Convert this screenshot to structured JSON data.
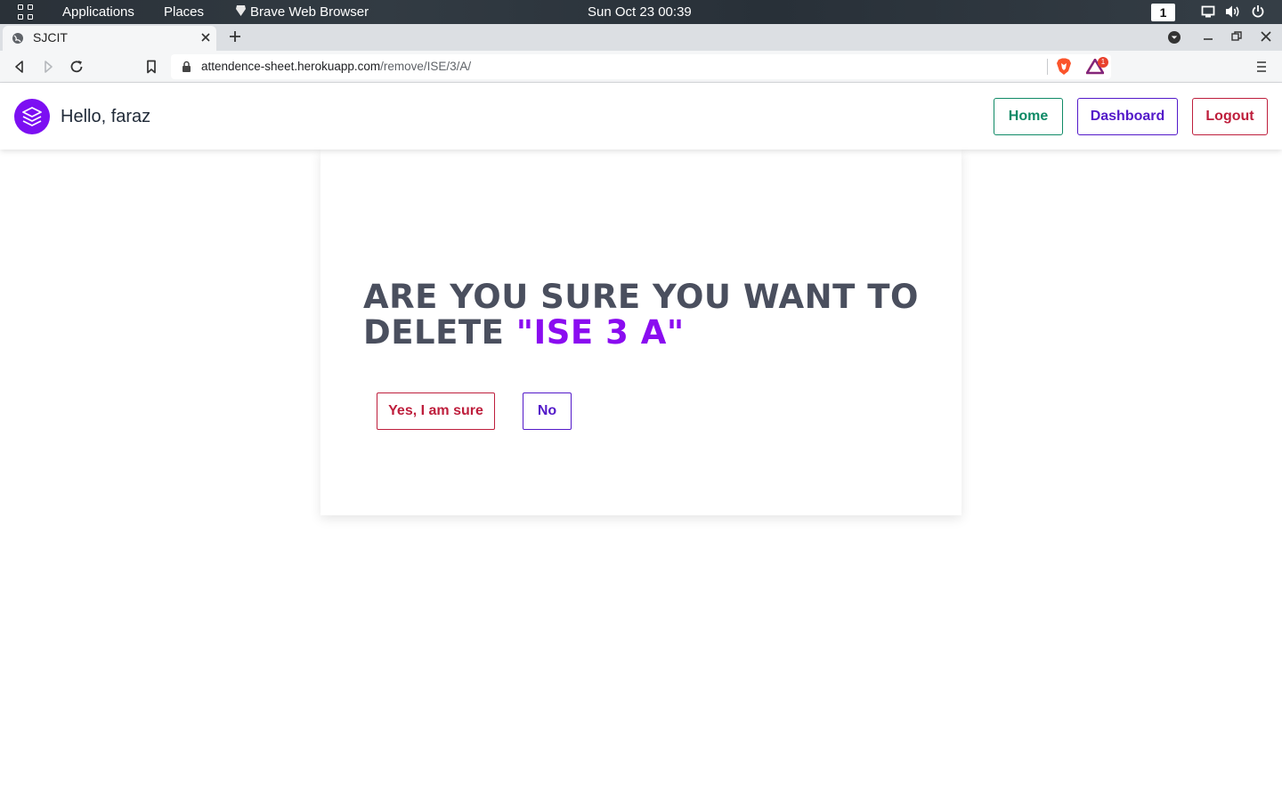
{
  "desktop": {
    "activities_icon": "apps-grid-icon",
    "applications_label": "Applications",
    "places_label": "Places",
    "active_app_label": "Brave Web Browser",
    "clock": "Sun Oct 23  00:39",
    "workspace_number": "1"
  },
  "browser": {
    "tab_title": "SJCIT",
    "url_host": "attendence-sheet.herokuapp.com",
    "url_path": "/remove/ISE/3/A/",
    "rewards_badge_count": "1"
  },
  "page": {
    "greeting": "Hello, faraz",
    "nav": {
      "home_label": "Home",
      "dashboard_label": "Dashboard",
      "logout_label": "Logout"
    },
    "confirm": {
      "headline_prefix": "ARE YOU SURE YOU WANT TO DELETE ",
      "headline_target": "\"ISE 3 A\"",
      "yes_label": "Yes, I am sure",
      "no_label": "No"
    }
  },
  "colors": {
    "accent_purple": "#8a0cf0",
    "home_green": "#0f8a66",
    "dashboard_indigo": "#5319c9",
    "danger_red": "#be1e3c",
    "headline_gray": "#4a4f5e"
  }
}
